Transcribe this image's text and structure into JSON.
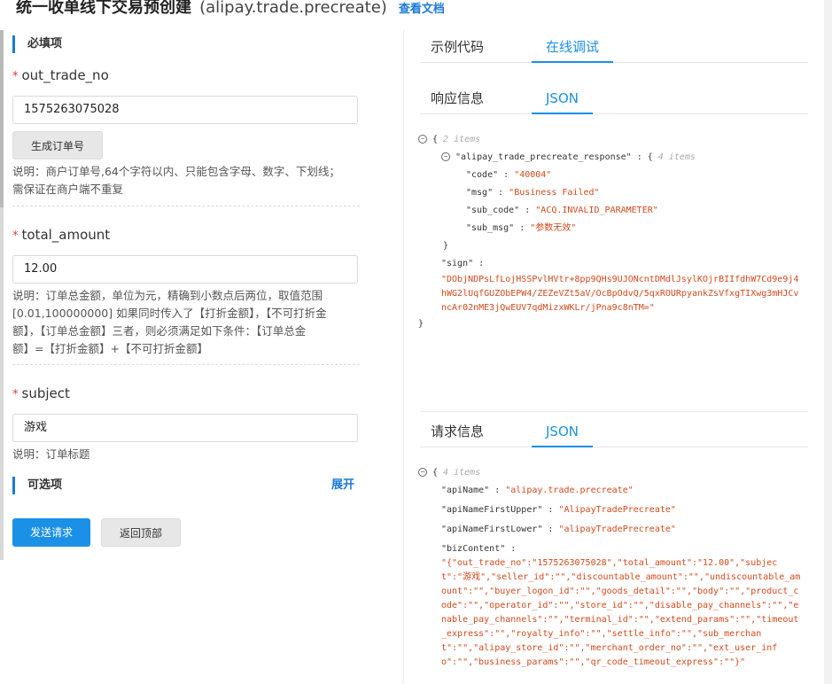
{
  "header": {
    "title": "统一收单线下交易预创建",
    "api": "(alipay.trade.precreate)",
    "doc_link": "查看文档"
  },
  "required_section": {
    "label": "必填项"
  },
  "optional_section": {
    "label": "可选项",
    "expand": "展开"
  },
  "fields": {
    "out_trade_no": {
      "label": "out_trade_no",
      "value": "1575263075028",
      "generate_button": "生成订单号",
      "desc_1": "说明：商户订单号,64个字符以内、只能包含字母、数字、下划线；",
      "desc_2": "需保证在商户端不重复"
    },
    "total_amount": {
      "label": "total_amount",
      "value": "12.00",
      "desc_1": "说明：订单总金额，单位为元，精确到小数点后两位，取值范围",
      "desc_2": "[0.01,100000000] 如果同时传入了【打折金额】，【不可打折金",
      "desc_3": "额】，【订单总金额】三者，则必须满足如下条件：【订单总金",
      "desc_4": "额】=【打折金额】+【不可打折金额】"
    },
    "subject": {
      "label": "subject",
      "value": "游戏",
      "desc": "说明：订单标题"
    }
  },
  "actions": {
    "send": "发送请求",
    "back_top": "返回顶部"
  },
  "right_tabs": {
    "sample": "示例代码",
    "debug": "在线调试"
  },
  "response": {
    "tab_info": "响应信息",
    "tab_json": "JSON",
    "root_count": "2 items",
    "resp_key": "\"alipay_trade_precreate_response\" : {",
    "resp_count": "4 items",
    "code": "\"code\" : \"40004\"",
    "msg": "\"msg\" : \"Business Failed\"",
    "sub_code": "\"sub_code\" : \"ACQ.INVALID_PARAMETER\"",
    "sub_msg": "\"sub_msg\" : \"参数无效\"",
    "sign_key": "\"sign\" :",
    "sign_value": "\"DObjNDPsLfLojHSSPvlHVtr+8pp9QHs9UJONcntDMdlJsylKOjrBIIfdhW7Cd9e9j4hWG2lUqfGUZObEPW4/ZEZeVZt5aV/OcBpOdvQ/5qxROURpyankZsVfxgTIXwg3mHJCvncAr02nME3jQwEUV7qdMizxWKLr/jPna9c8nTM=\""
  },
  "request": {
    "tab_info": "请求信息",
    "tab_json": "JSON",
    "root_count": "4 items",
    "apiName": "\"apiName\" : \"alipay.trade.precreate\"",
    "apiNameFirstUpper": "\"apiNameFirstUpper\" : \"AlipayTradePrecreate\"",
    "apiNameFirstLower": "\"apiNameFirstLower\" : \"alipayTradePrecreate\"",
    "bizContent_key": "\"bizContent\" :",
    "bizContent_value": "\"{\"out_trade_no\":\"1575263075028\",\"total_amount\":\"12.00\",\"subject\":\"游戏\",\"seller_id\":\"\",\"discountable_amount\":\"\",\"undiscountable_amount\":\"\",\"buyer_logon_id\":\"\",\"goods_detail\":\"\",\"body\":\"\",\"product_code\":\"\",\"operator_id\":\"\",\"store_id\":\"\",\"disable_pay_channels\":\"\",\"enable_pay_channels\":\"\",\"terminal_id\":\"\",\"extend_params\":\"\",\"timeout_express\":\"\",\"royalty_info\":\"\",\"settle_info\":\"\",\"sub_merchant\":\"\",\"alipay_store_id\":\"\",\"merchant_order_no\":\"\",\"ext_user_info\":\"\",\"business_params\":\"\",\"qr_code_timeout_express\":\"\"}\""
  }
}
